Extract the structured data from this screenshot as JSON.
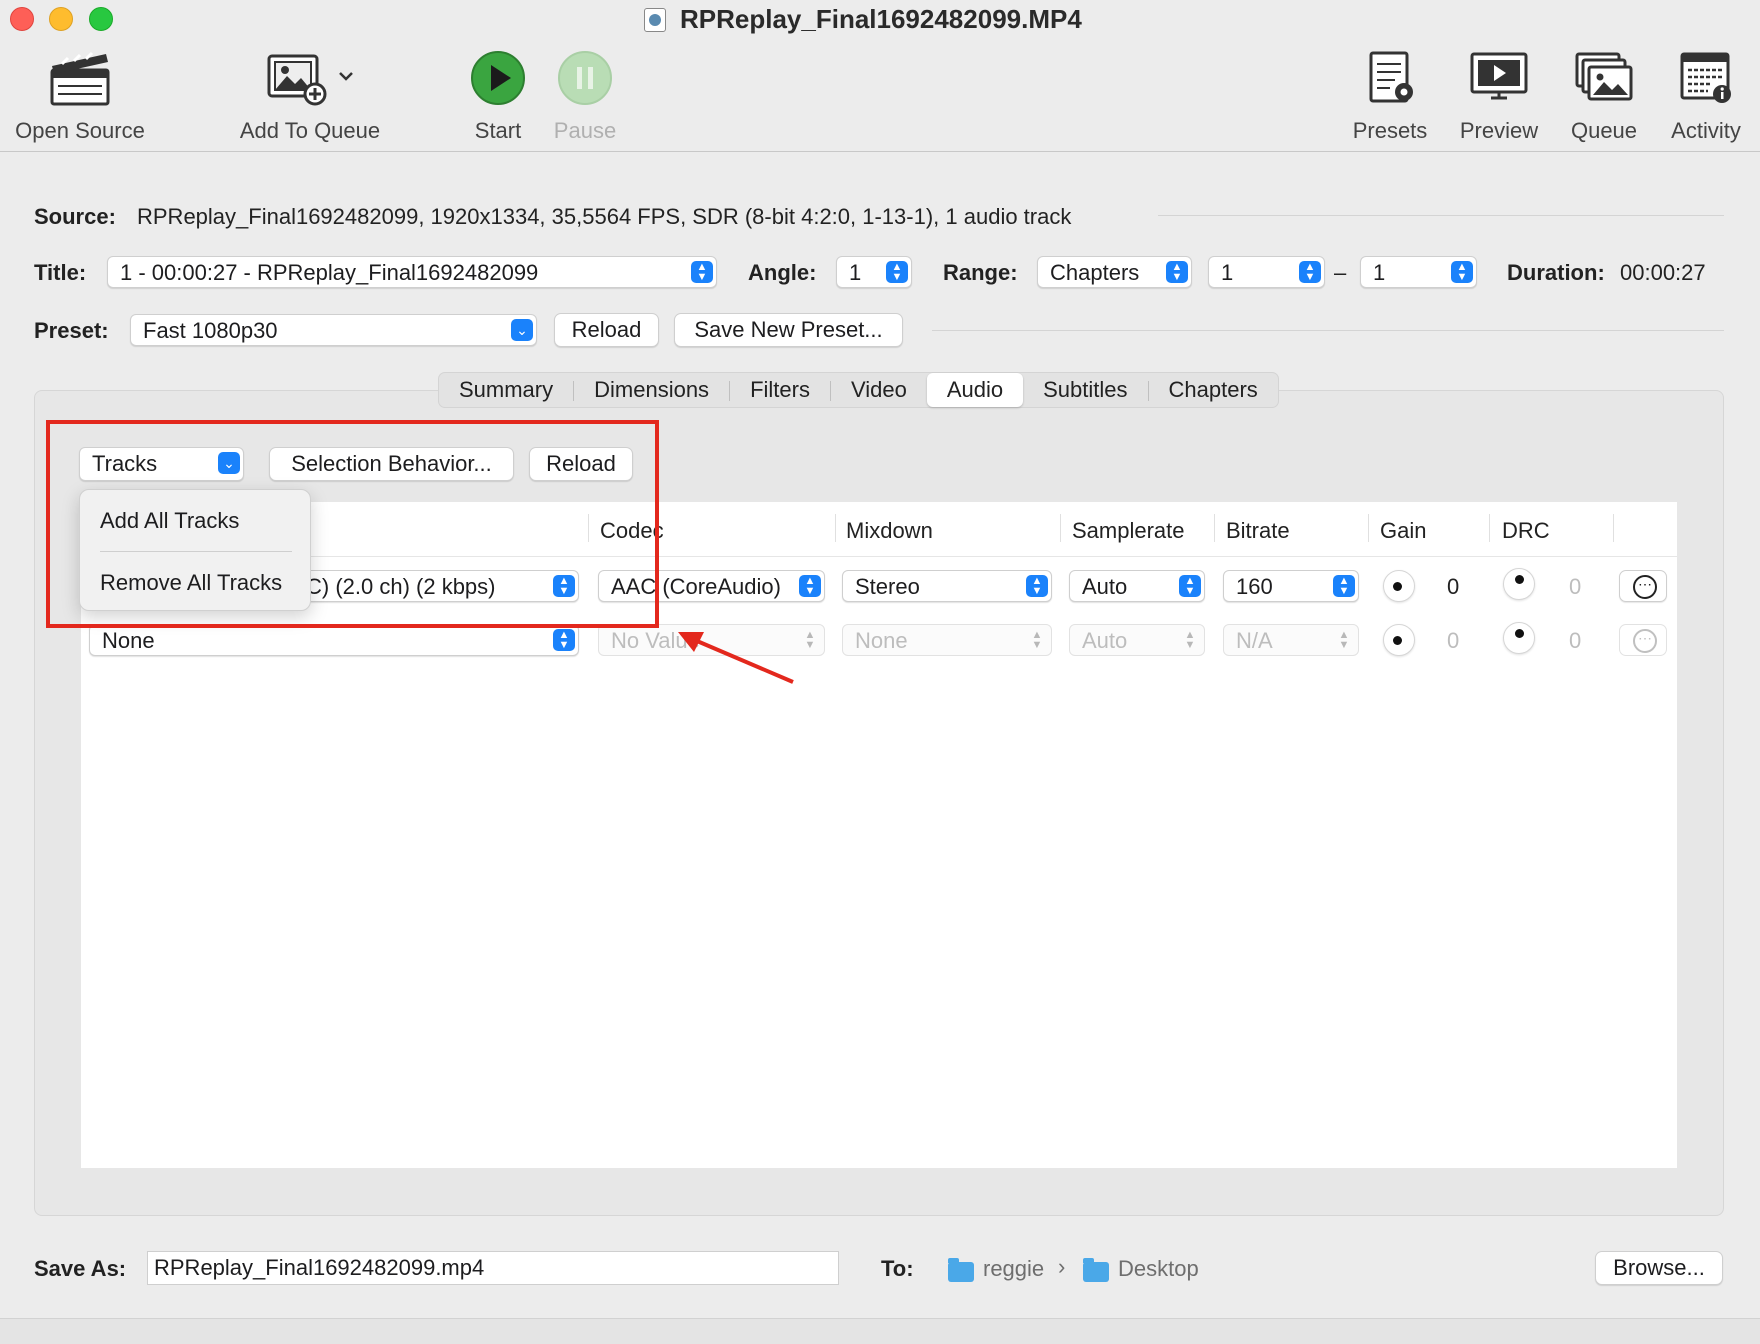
{
  "window": {
    "title": "RPReplay_Final1692482099.MP4"
  },
  "toolbar": {
    "open_source": "Open Source",
    "add_to_queue": "Add To Queue",
    "start": "Start",
    "pause": "Pause",
    "presets": "Presets",
    "preview": "Preview",
    "queue": "Queue",
    "activity": "Activity"
  },
  "source": {
    "label": "Source:",
    "value": "RPReplay_Final1692482099, 1920x1334, 35,5564 FPS, SDR (8-bit 4:2:0, 1-13-1), 1 audio track"
  },
  "title_row": {
    "title_label": "Title:",
    "title_value": "1 - 00:00:27 - RPReplay_Final1692482099",
    "angle_label": "Angle:",
    "angle_value": "1",
    "range_label": "Range:",
    "range_type": "Chapters",
    "range_start": "1",
    "range_dash": "–",
    "range_end": "1",
    "duration_label": "Duration:",
    "duration_value": "00:00:27"
  },
  "preset_row": {
    "label": "Preset:",
    "value": "Fast 1080p30",
    "reload": "Reload",
    "save_new": "Save New Preset..."
  },
  "tabs": [
    "Summary",
    "Dimensions",
    "Filters",
    "Video",
    "Audio",
    "Subtitles",
    "Chapters"
  ],
  "active_tab": "Audio",
  "audio": {
    "tracks_button": "Tracks",
    "selection_behavior": "Selection Behavior...",
    "reload": "Reload",
    "menu": {
      "add_all": "Add All Tracks",
      "remove_all": "Remove All Tracks"
    },
    "columns": {
      "codec": "Codec",
      "mixdown": "Mixdown",
      "samplerate": "Samplerate",
      "bitrate": "Bitrate",
      "gain": "Gain",
      "drc": "DRC"
    },
    "rows": [
      {
        "track": "C) (2.0 ch) (2 kbps)",
        "codec": "AAC (CoreAudio)",
        "mixdown": "Stereo",
        "samplerate": "Auto",
        "bitrate": "160",
        "gain": "0",
        "drc": "0"
      },
      {
        "track": "None",
        "codec": "No Value",
        "mixdown": "None",
        "samplerate": "Auto",
        "bitrate": "N/A",
        "gain": "0",
        "drc": "0"
      }
    ]
  },
  "save": {
    "label": "Save As:",
    "filename": "RPReplay_Final1692482099.mp4",
    "to_label": "To:",
    "path_user": "reggie",
    "path_sep": "›",
    "path_folder": "Desktop",
    "browse": "Browse..."
  },
  "colors": {
    "accent": "#1a82fb",
    "highlight": "#e3281d",
    "start_green": "#3aa540"
  }
}
